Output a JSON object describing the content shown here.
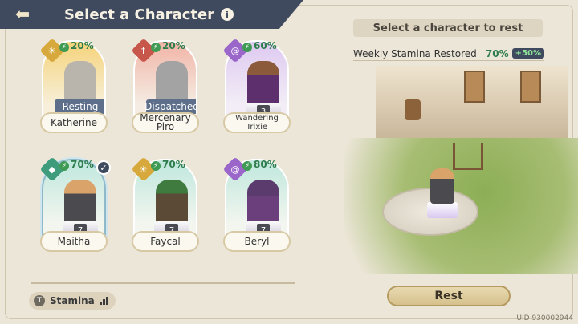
{
  "header": {
    "title": "Select a Character",
    "info": "i"
  },
  "characters": [
    {
      "name": "Katherine",
      "stamina": "20%",
      "status": "Resting",
      "theme": "gold",
      "icon": "sun-icon"
    },
    {
      "name": "Mercenary Piro",
      "stamina": "20%",
      "status": "Dispatched",
      "theme": "red",
      "icon": "sword-icon"
    },
    {
      "name": "Wandering Trixie",
      "stamina": "60%",
      "level": "3",
      "theme": "purple",
      "icon": "spiral-icon"
    },
    {
      "name": "Maitha",
      "stamina": "70%",
      "level": "7",
      "theme": "teal",
      "selected": true,
      "icon": "shield-icon"
    },
    {
      "name": "Faycal",
      "stamina": "70%",
      "level": "7",
      "theme": "gold",
      "icon": "sun-icon"
    },
    {
      "name": "Beryl",
      "stamina": "80%",
      "level": "7",
      "theme": "purple",
      "icon": "spiral-icon"
    }
  ],
  "footer": {
    "stamina_label": "Stamina"
  },
  "right": {
    "prompt": "Select a character to rest",
    "weekly_label": "Weekly Stamina Restored",
    "weekly_value": "70%",
    "weekly_bonus": "+50%",
    "rest_button": "Rest"
  },
  "uid": "UID 930002944"
}
